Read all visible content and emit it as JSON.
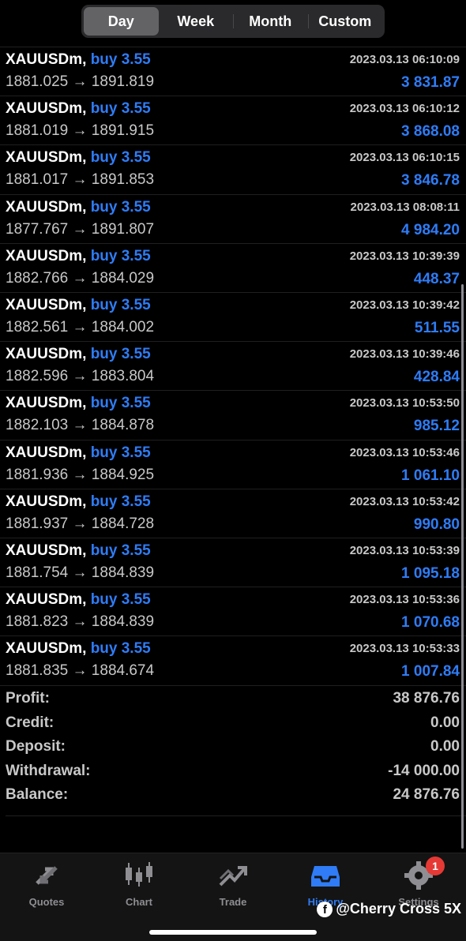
{
  "period_tabs": [
    {
      "label": "Day",
      "active": true
    },
    {
      "label": "Week",
      "active": false
    },
    {
      "label": "Month",
      "active": false
    },
    {
      "label": "Custom",
      "active": false
    }
  ],
  "deals": [
    {
      "symbol": "XAUUSDm,",
      "side": "buy 3.55",
      "prices": "1881.025 → 1891.819",
      "time": "2023.03.13 06:10:09",
      "profit": "3 831.87"
    },
    {
      "symbol": "XAUUSDm,",
      "side": "buy 3.55",
      "prices": "1881.019 → 1891.915",
      "time": "2023.03.13 06:10:12",
      "profit": "3 868.08"
    },
    {
      "symbol": "XAUUSDm,",
      "side": "buy 3.55",
      "prices": "1881.017 → 1891.853",
      "time": "2023.03.13 06:10:15",
      "profit": "3 846.78"
    },
    {
      "symbol": "XAUUSDm,",
      "side": "buy 3.55",
      "prices": "1877.767 → 1891.807",
      "time": "2023.03.13 08:08:11",
      "profit": "4 984.20"
    },
    {
      "symbol": "XAUUSDm,",
      "side": "buy 3.55",
      "prices": "1882.766 → 1884.029",
      "time": "2023.03.13 10:39:39",
      "profit": "448.37"
    },
    {
      "symbol": "XAUUSDm,",
      "side": "buy 3.55",
      "prices": "1882.561 → 1884.002",
      "time": "2023.03.13 10:39:42",
      "profit": "511.55"
    },
    {
      "symbol": "XAUUSDm,",
      "side": "buy 3.55",
      "prices": "1882.596 → 1883.804",
      "time": "2023.03.13 10:39:46",
      "profit": "428.84"
    },
    {
      "symbol": "XAUUSDm,",
      "side": "buy 3.55",
      "prices": "1882.103 → 1884.878",
      "time": "2023.03.13 10:53:50",
      "profit": "985.12"
    },
    {
      "symbol": "XAUUSDm,",
      "side": "buy 3.55",
      "prices": "1881.936 → 1884.925",
      "time": "2023.03.13 10:53:46",
      "profit": "1 061.10"
    },
    {
      "symbol": "XAUUSDm,",
      "side": "buy 3.55",
      "prices": "1881.937 → 1884.728",
      "time": "2023.03.13 10:53:42",
      "profit": "990.80"
    },
    {
      "symbol": "XAUUSDm,",
      "side": "buy 3.55",
      "prices": "1881.754 → 1884.839",
      "time": "2023.03.13 10:53:39",
      "profit": "1 095.18"
    },
    {
      "symbol": "XAUUSDm,",
      "side": "buy 3.55",
      "prices": "1881.823 → 1884.839",
      "time": "2023.03.13 10:53:36",
      "profit": "1 070.68"
    },
    {
      "symbol": "XAUUSDm,",
      "side": "buy 3.55",
      "prices": "1881.835 → 1884.674",
      "time": "2023.03.13 10:53:33",
      "profit": "1 007.84"
    }
  ],
  "summary": [
    {
      "label": "Profit:",
      "value": "38 876.76"
    },
    {
      "label": "Credit:",
      "value": "0.00"
    },
    {
      "label": "Deposit:",
      "value": "0.00"
    },
    {
      "label": "Withdrawal:",
      "value": "-14 000.00"
    },
    {
      "label": "Balance:",
      "value": "24 876.76"
    }
  ],
  "tabbar": [
    {
      "label": "Quotes",
      "icon": "quotes-arrows-icon",
      "active": false
    },
    {
      "label": "Chart",
      "icon": "candlestick-icon",
      "active": false
    },
    {
      "label": "Trade",
      "icon": "trade-trend-icon",
      "active": false
    },
    {
      "label": "History",
      "icon": "history-inbox-icon",
      "active": true
    },
    {
      "label": "Settings",
      "icon": "gear-icon",
      "active": false,
      "badge": "1"
    }
  ],
  "watermark": {
    "text": "@Cherry Cross 5X"
  },
  "colors": {
    "accent": "#2f7cf6",
    "background": "#000000",
    "muted_text": "#c8c8c8",
    "badge": "#e53935"
  }
}
